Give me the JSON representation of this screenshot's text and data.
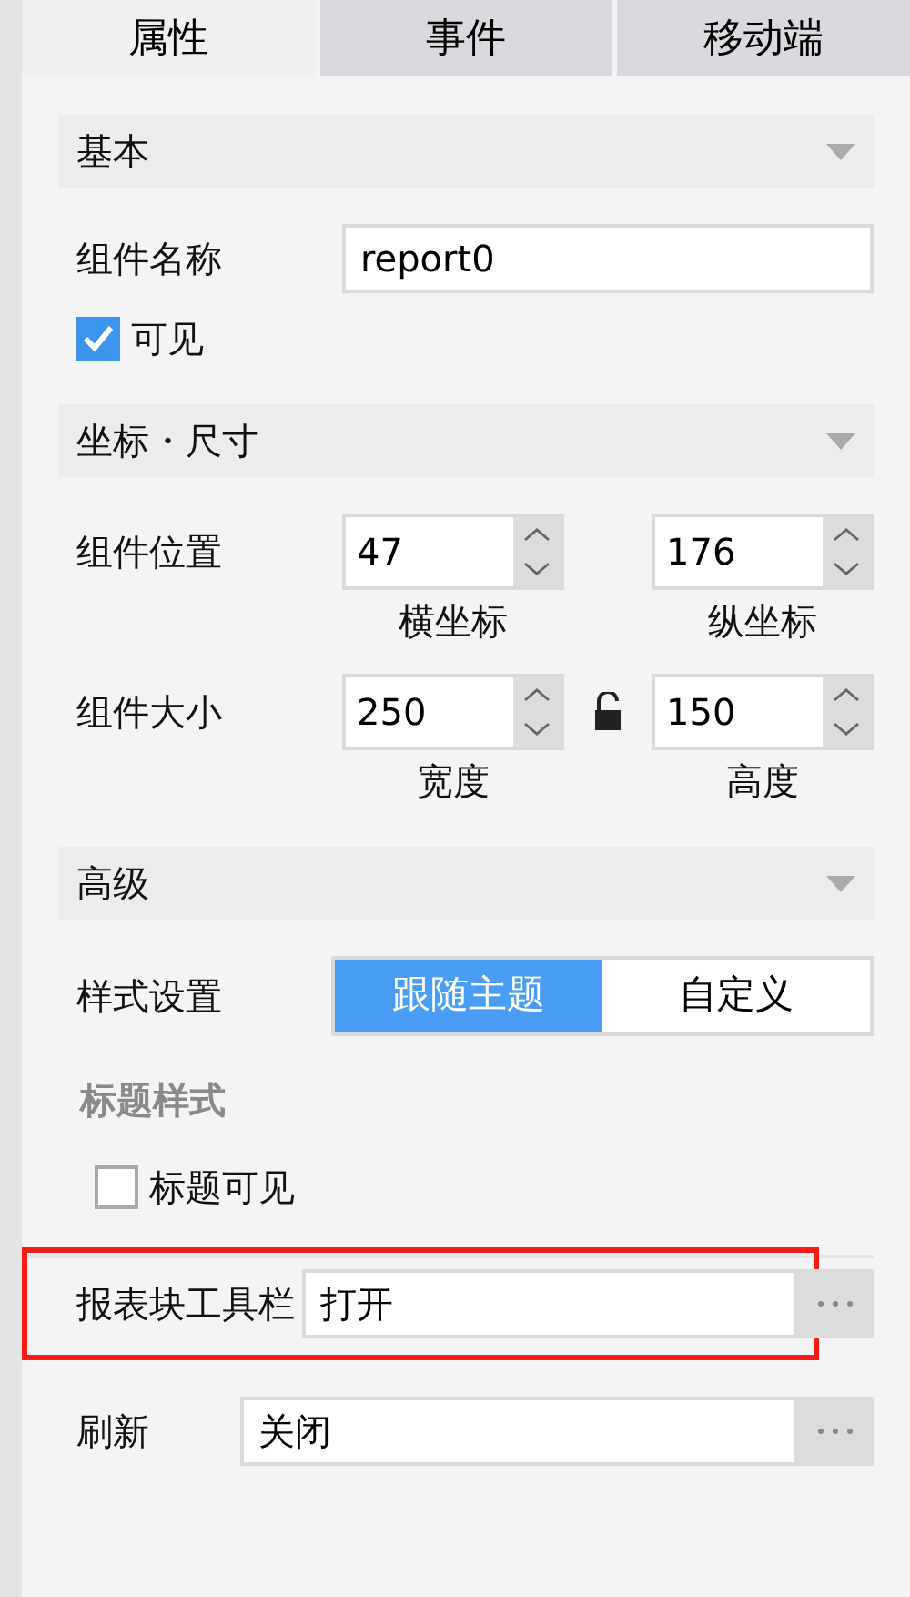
{
  "tabs": [
    {
      "label": "属性",
      "selected": true
    },
    {
      "label": "事件",
      "selected": false
    },
    {
      "label": "移动端",
      "selected": false
    }
  ],
  "sections": [
    {
      "title": "基本",
      "items": [
        {
          "kind": "text",
          "label": "组件名称",
          "value": "report0"
        },
        {
          "kind": "checkbox",
          "label": "可见",
          "checked": true
        }
      ]
    },
    {
      "title": "坐标・尺寸",
      "items": [
        {
          "kind": "spinners",
          "label": "组件位置",
          "fields": [
            {
              "value": "47",
              "caption": "横坐标"
            },
            {
              "value": "176",
              "caption": "纵坐标"
            }
          ]
        },
        {
          "kind": "spinners",
          "label": "组件大小",
          "locked": false,
          "fields": [
            {
              "value": "250",
              "caption": "宽度"
            },
            {
              "value": "150",
              "caption": "高度"
            }
          ]
        }
      ]
    },
    {
      "title": "高级",
      "items": [
        {
          "kind": "segmented",
          "label": "样式设置",
          "options": [
            {
              "label": "跟随主题",
              "selected": true
            },
            {
              "label": "自定义",
              "selected": false
            }
          ]
        },
        {
          "kind": "subheading",
          "label": "标题样式"
        },
        {
          "kind": "checkbox",
          "label": "标题可见",
          "checked": false
        },
        {
          "kind": "picker",
          "label": "报表块工具栏",
          "value": "打开",
          "highlighted": true
        },
        {
          "kind": "picker",
          "label": "刷新",
          "value": "关闭",
          "highlighted": false
        }
      ]
    }
  ]
}
